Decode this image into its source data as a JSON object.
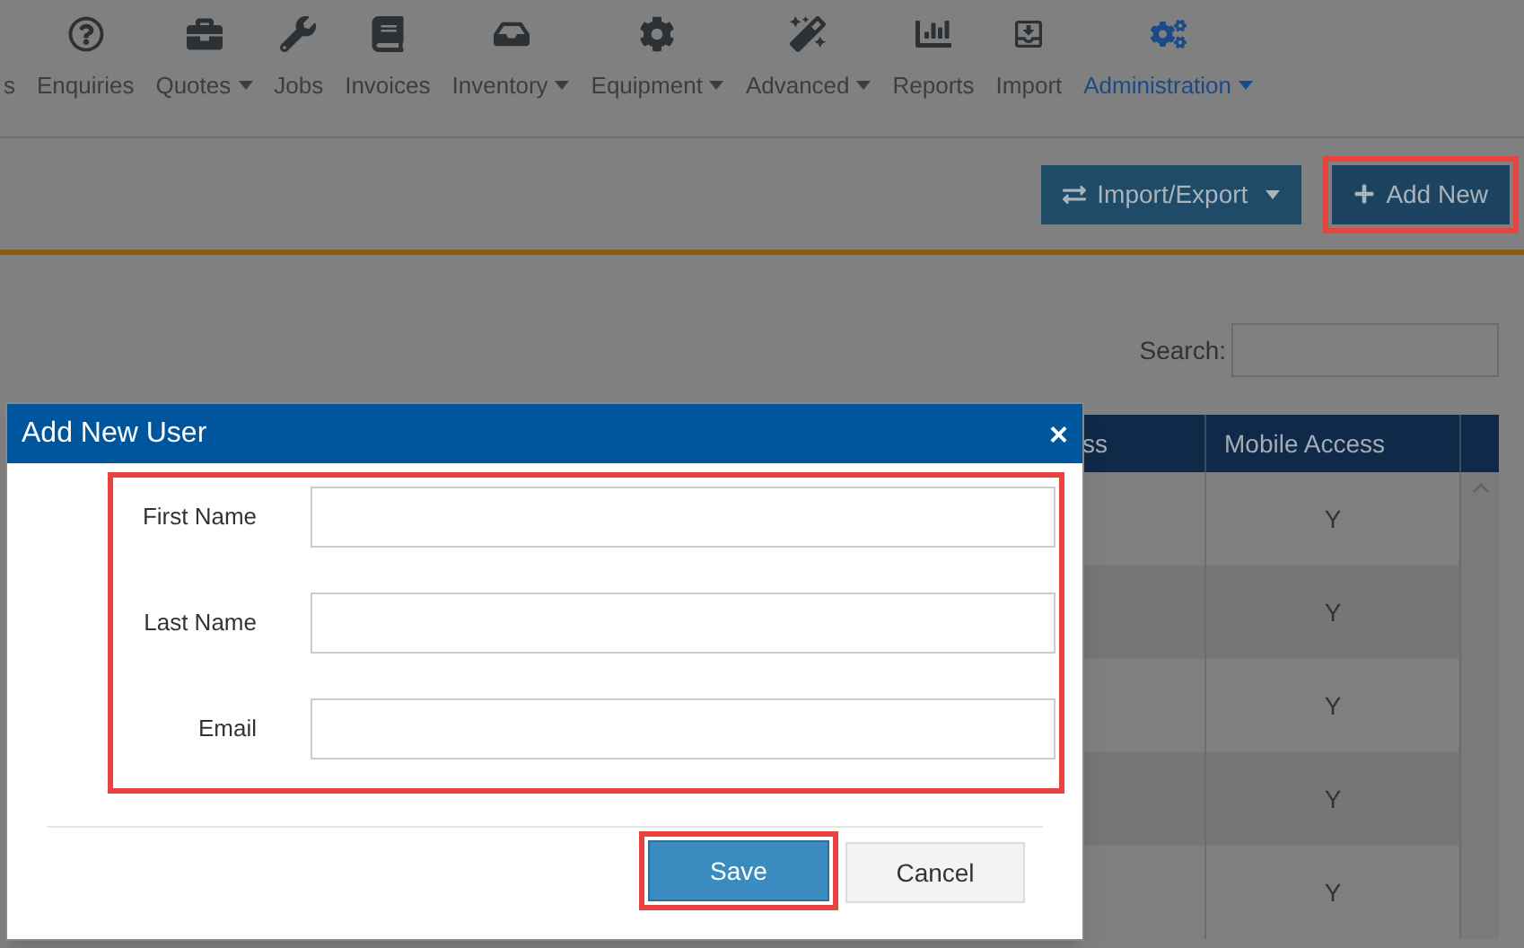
{
  "nav": [
    {
      "label": "s",
      "caret": false,
      "selected": false
    },
    {
      "label": "Enquiries",
      "caret": false,
      "selected": false
    },
    {
      "label": "Quotes",
      "caret": true,
      "selected": false
    },
    {
      "label": "Jobs",
      "caret": false,
      "selected": false
    },
    {
      "label": "Invoices",
      "caret": false,
      "selected": false
    },
    {
      "label": "Inventory",
      "caret": true,
      "selected": false
    },
    {
      "label": "Equipment",
      "caret": true,
      "selected": false
    },
    {
      "label": "Advanced",
      "caret": true,
      "selected": false
    },
    {
      "label": "Reports",
      "caret": false,
      "selected": false
    },
    {
      "label": "Import",
      "caret": false,
      "selected": false
    },
    {
      "label": "Administration",
      "caret": true,
      "selected": true
    }
  ],
  "toolbar": {
    "import_export": "Import/Export",
    "add_new": "Add New"
  },
  "search": {
    "label": "Search:"
  },
  "table": {
    "columns": [
      "ss",
      "Mobile Access"
    ],
    "rows": [
      [
        "Y"
      ],
      [
        "Y"
      ],
      [
        "Y"
      ],
      [
        "Y"
      ],
      [
        "Y"
      ]
    ]
  },
  "dialog": {
    "title": "Add New User",
    "close": "×",
    "fields": [
      {
        "label": "First Name"
      },
      {
        "label": "Last Name"
      },
      {
        "label": "Email"
      }
    ],
    "save": "Save",
    "cancel": "Cancel"
  }
}
